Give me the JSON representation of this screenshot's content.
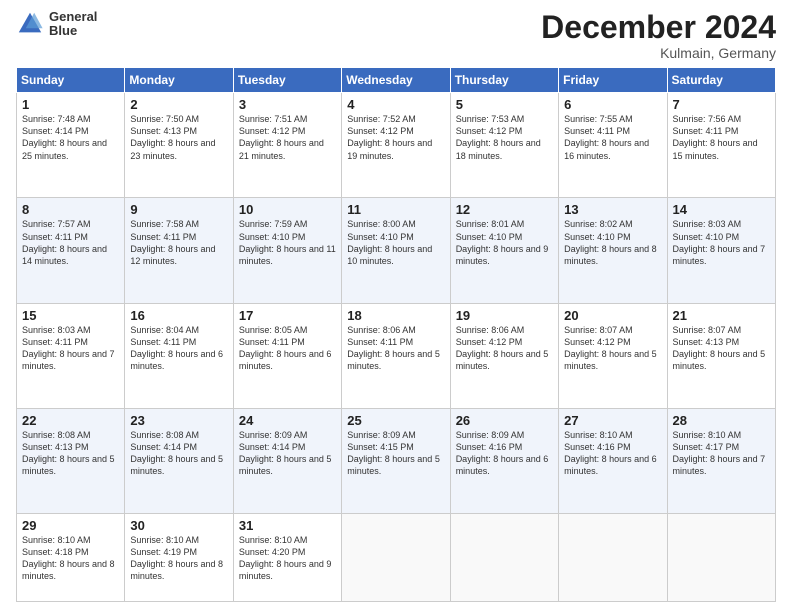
{
  "header": {
    "logo_line1": "General",
    "logo_line2": "Blue",
    "month": "December 2024",
    "location": "Kulmain, Germany"
  },
  "days_of_week": [
    "Sunday",
    "Monday",
    "Tuesday",
    "Wednesday",
    "Thursday",
    "Friday",
    "Saturday"
  ],
  "weeks": [
    [
      {
        "num": "1",
        "sunrise": "7:48 AM",
        "sunset": "4:14 PM",
        "daylight": "8 hours and 25 minutes."
      },
      {
        "num": "2",
        "sunrise": "7:50 AM",
        "sunset": "4:13 PM",
        "daylight": "8 hours and 23 minutes."
      },
      {
        "num": "3",
        "sunrise": "7:51 AM",
        "sunset": "4:12 PM",
        "daylight": "8 hours and 21 minutes."
      },
      {
        "num": "4",
        "sunrise": "7:52 AM",
        "sunset": "4:12 PM",
        "daylight": "8 hours and 19 minutes."
      },
      {
        "num": "5",
        "sunrise": "7:53 AM",
        "sunset": "4:12 PM",
        "daylight": "8 hours and 18 minutes."
      },
      {
        "num": "6",
        "sunrise": "7:55 AM",
        "sunset": "4:11 PM",
        "daylight": "8 hours and 16 minutes."
      },
      {
        "num": "7",
        "sunrise": "7:56 AM",
        "sunset": "4:11 PM",
        "daylight": "8 hours and 15 minutes."
      }
    ],
    [
      {
        "num": "8",
        "sunrise": "7:57 AM",
        "sunset": "4:11 PM",
        "daylight": "8 hours and 14 minutes."
      },
      {
        "num": "9",
        "sunrise": "7:58 AM",
        "sunset": "4:11 PM",
        "daylight": "8 hours and 12 minutes."
      },
      {
        "num": "10",
        "sunrise": "7:59 AM",
        "sunset": "4:10 PM",
        "daylight": "8 hours and 11 minutes."
      },
      {
        "num": "11",
        "sunrise": "8:00 AM",
        "sunset": "4:10 PM",
        "daylight": "8 hours and 10 minutes."
      },
      {
        "num": "12",
        "sunrise": "8:01 AM",
        "sunset": "4:10 PM",
        "daylight": "8 hours and 9 minutes."
      },
      {
        "num": "13",
        "sunrise": "8:02 AM",
        "sunset": "4:10 PM",
        "daylight": "8 hours and 8 minutes."
      },
      {
        "num": "14",
        "sunrise": "8:03 AM",
        "sunset": "4:10 PM",
        "daylight": "8 hours and 7 minutes."
      }
    ],
    [
      {
        "num": "15",
        "sunrise": "8:03 AM",
        "sunset": "4:11 PM",
        "daylight": "8 hours and 7 minutes."
      },
      {
        "num": "16",
        "sunrise": "8:04 AM",
        "sunset": "4:11 PM",
        "daylight": "8 hours and 6 minutes."
      },
      {
        "num": "17",
        "sunrise": "8:05 AM",
        "sunset": "4:11 PM",
        "daylight": "8 hours and 6 minutes."
      },
      {
        "num": "18",
        "sunrise": "8:06 AM",
        "sunset": "4:11 PM",
        "daylight": "8 hours and 5 minutes."
      },
      {
        "num": "19",
        "sunrise": "8:06 AM",
        "sunset": "4:12 PM",
        "daylight": "8 hours and 5 minutes."
      },
      {
        "num": "20",
        "sunrise": "8:07 AM",
        "sunset": "4:12 PM",
        "daylight": "8 hours and 5 minutes."
      },
      {
        "num": "21",
        "sunrise": "8:07 AM",
        "sunset": "4:13 PM",
        "daylight": "8 hours and 5 minutes."
      }
    ],
    [
      {
        "num": "22",
        "sunrise": "8:08 AM",
        "sunset": "4:13 PM",
        "daylight": "8 hours and 5 minutes."
      },
      {
        "num": "23",
        "sunrise": "8:08 AM",
        "sunset": "4:14 PM",
        "daylight": "8 hours and 5 minutes."
      },
      {
        "num": "24",
        "sunrise": "8:09 AM",
        "sunset": "4:14 PM",
        "daylight": "8 hours and 5 minutes."
      },
      {
        "num": "25",
        "sunrise": "8:09 AM",
        "sunset": "4:15 PM",
        "daylight": "8 hours and 5 minutes."
      },
      {
        "num": "26",
        "sunrise": "8:09 AM",
        "sunset": "4:16 PM",
        "daylight": "8 hours and 6 minutes."
      },
      {
        "num": "27",
        "sunrise": "8:10 AM",
        "sunset": "4:16 PM",
        "daylight": "8 hours and 6 minutes."
      },
      {
        "num": "28",
        "sunrise": "8:10 AM",
        "sunset": "4:17 PM",
        "daylight": "8 hours and 7 minutes."
      }
    ],
    [
      {
        "num": "29",
        "sunrise": "8:10 AM",
        "sunset": "4:18 PM",
        "daylight": "8 hours and 8 minutes."
      },
      {
        "num": "30",
        "sunrise": "8:10 AM",
        "sunset": "4:19 PM",
        "daylight": "8 hours and 8 minutes."
      },
      {
        "num": "31",
        "sunrise": "8:10 AM",
        "sunset": "4:20 PM",
        "daylight": "8 hours and 9 minutes."
      },
      null,
      null,
      null,
      null
    ]
  ]
}
